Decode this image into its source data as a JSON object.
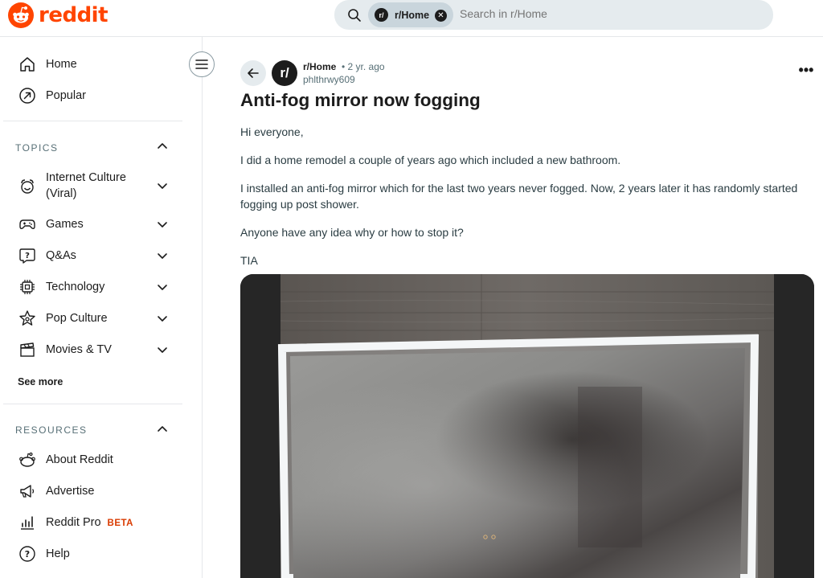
{
  "header": {
    "brand": "reddit",
    "search": {
      "chip_avatar": "r/",
      "chip_label": "r/Home",
      "placeholder": "Search in r/Home"
    }
  },
  "sidebar": {
    "primary": [
      {
        "label": "Home",
        "icon": "home-icon"
      },
      {
        "label": "Popular",
        "icon": "popular-icon"
      }
    ],
    "topics": {
      "title": "TOPICS",
      "items": [
        {
          "label": "Internet Culture",
          "label2": "(Viral)",
          "icon": "internet-culture-icon"
        },
        {
          "label": "Games",
          "icon": "gamepad-icon"
        },
        {
          "label": "Q&As",
          "icon": "question-bubble-icon"
        },
        {
          "label": "Technology",
          "icon": "chip-icon"
        },
        {
          "label": "Pop Culture",
          "icon": "star-icon"
        },
        {
          "label": "Movies & TV",
          "icon": "clapperboard-icon"
        }
      ],
      "see_more": "See more"
    },
    "resources": {
      "title": "RESOURCES",
      "items": [
        {
          "label": "About Reddit",
          "icon": "reddit-alien-icon"
        },
        {
          "label": "Advertise",
          "icon": "megaphone-icon"
        },
        {
          "label": "Reddit Pro",
          "badge": "BETA",
          "icon": "bar-chart-icon"
        },
        {
          "label": "Help",
          "icon": "help-icon"
        }
      ]
    }
  },
  "post": {
    "subreddit_avatar": "r/",
    "subreddit": "r/Home",
    "meta": "• 2 yr. ago",
    "author": "phlthrwy609",
    "title": "Anti-fog mirror now fogging",
    "body": [
      "Hi everyone,",
      "I did a home remodel a couple of years ago which included a new bathroom.",
      "I installed an anti-fog mirror which for the last two years never fogged. Now, 2 years later it has randomly started fogging up post shower.",
      "Anyone have any idea why or how to stop it?",
      "TIA"
    ],
    "more": "•••"
  },
  "colors": {
    "brand": "#ff4500",
    "beta": "#d93a00",
    "search_bg": "#e5ebee"
  }
}
